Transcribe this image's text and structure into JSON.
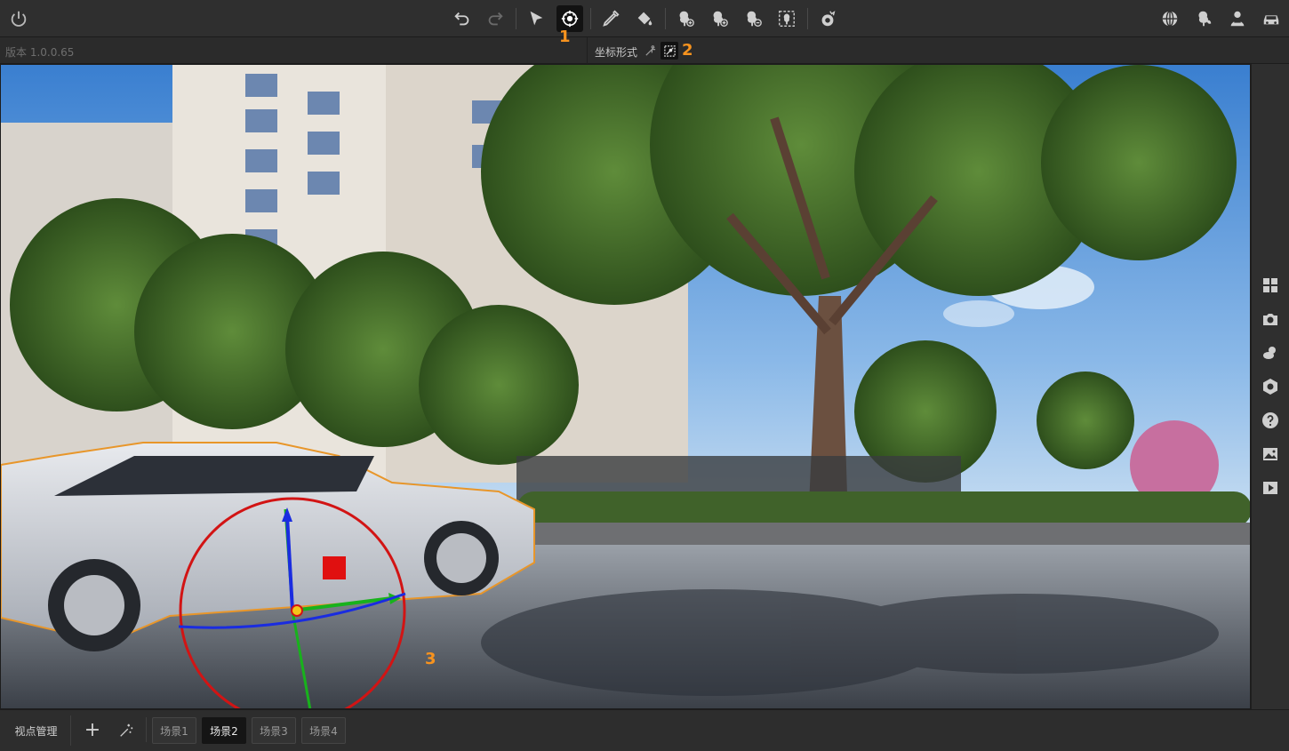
{
  "toolbar": {
    "left_icons": [
      {
        "name": "power-icon"
      }
    ],
    "center_icons": [
      {
        "name": "undo-icon",
        "enabled": true
      },
      {
        "name": "redo-icon",
        "enabled": false
      },
      {
        "name": "select-arrow-icon"
      },
      {
        "name": "transform-gizmo-icon",
        "active": true
      },
      {
        "name": "pen-tool-icon"
      },
      {
        "name": "paint-bucket-icon"
      },
      {
        "name": "tree-add-icon"
      },
      {
        "name": "tree-add-alt-icon"
      },
      {
        "name": "tree-remove-icon"
      },
      {
        "name": "tree-select-icon"
      },
      {
        "name": "weather-effect-icon"
      }
    ],
    "right_icons": [
      {
        "name": "globe-icon"
      },
      {
        "name": "vegetation-icon"
      },
      {
        "name": "character-icon"
      },
      {
        "name": "car-icon"
      }
    ]
  },
  "subbar": {
    "version": "版本 1.0.0.65",
    "coord_label": "坐标形式",
    "coord_options": [
      {
        "name": "world-coord-icon",
        "active": false
      },
      {
        "name": "local-coord-icon",
        "active": true
      }
    ]
  },
  "annotations": [
    "1",
    "2",
    "3"
  ],
  "right_sidebar": [
    {
      "name": "grid-view-icon"
    },
    {
      "name": "camera-icon"
    },
    {
      "name": "weather-icon"
    },
    {
      "name": "settings-icon"
    },
    {
      "name": "help-icon"
    },
    {
      "name": "image-icon"
    },
    {
      "name": "play-icon"
    }
  ],
  "bottom": {
    "viewpoint_manager": "视点管理",
    "add_label": "+",
    "scenes": [
      {
        "label": "场景1",
        "active": false
      },
      {
        "label": "场景2",
        "active": true
      },
      {
        "label": "场景3",
        "active": false
      },
      {
        "label": "场景4",
        "active": false
      }
    ]
  },
  "colors": {
    "accent_orange": "#f7931e",
    "gizmo_red": "#d21414",
    "gizmo_green": "#18b21c",
    "gizmo_blue": "#1a2ce0",
    "selection_outline": "#e8962a"
  }
}
